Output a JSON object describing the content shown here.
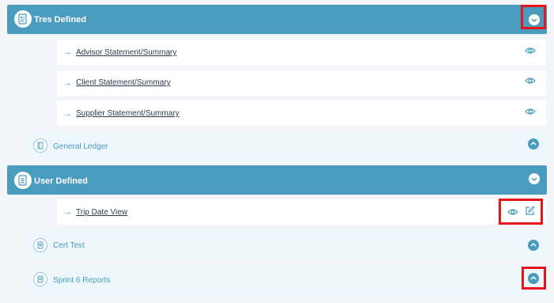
{
  "groups": [
    {
      "title": "Tres Defined",
      "icon": "document-chart-icon",
      "reports": [
        {
          "label": "Advisor Statement/Summary",
          "icons": [
            "eye-icon"
          ]
        },
        {
          "label": "Client Statement/Summary",
          "icons": [
            "eye-icon"
          ]
        },
        {
          "label": "Supplier Statement/Summary",
          "icons": [
            "eye-icon"
          ]
        }
      ],
      "subgroups": [
        {
          "title": "General Ledger",
          "icon": "ledger-icon"
        }
      ]
    },
    {
      "title": "User Defined",
      "icon": "user-document-icon",
      "reports": [
        {
          "label": "Trip Date View",
          "icons": [
            "eye-icon",
            "edit-icon"
          ]
        }
      ],
      "subgroups": [
        {
          "title": "Cert Test",
          "icon": "badge-icon"
        },
        {
          "title": "Sprint 6 Reports",
          "icon": "badge-icon"
        }
      ]
    }
  ],
  "arrow_glyph": "→",
  "colors": {
    "accent": "#4a9cbf",
    "highlight": "#e8141c",
    "subgroup_bg": "#edf7fc"
  }
}
